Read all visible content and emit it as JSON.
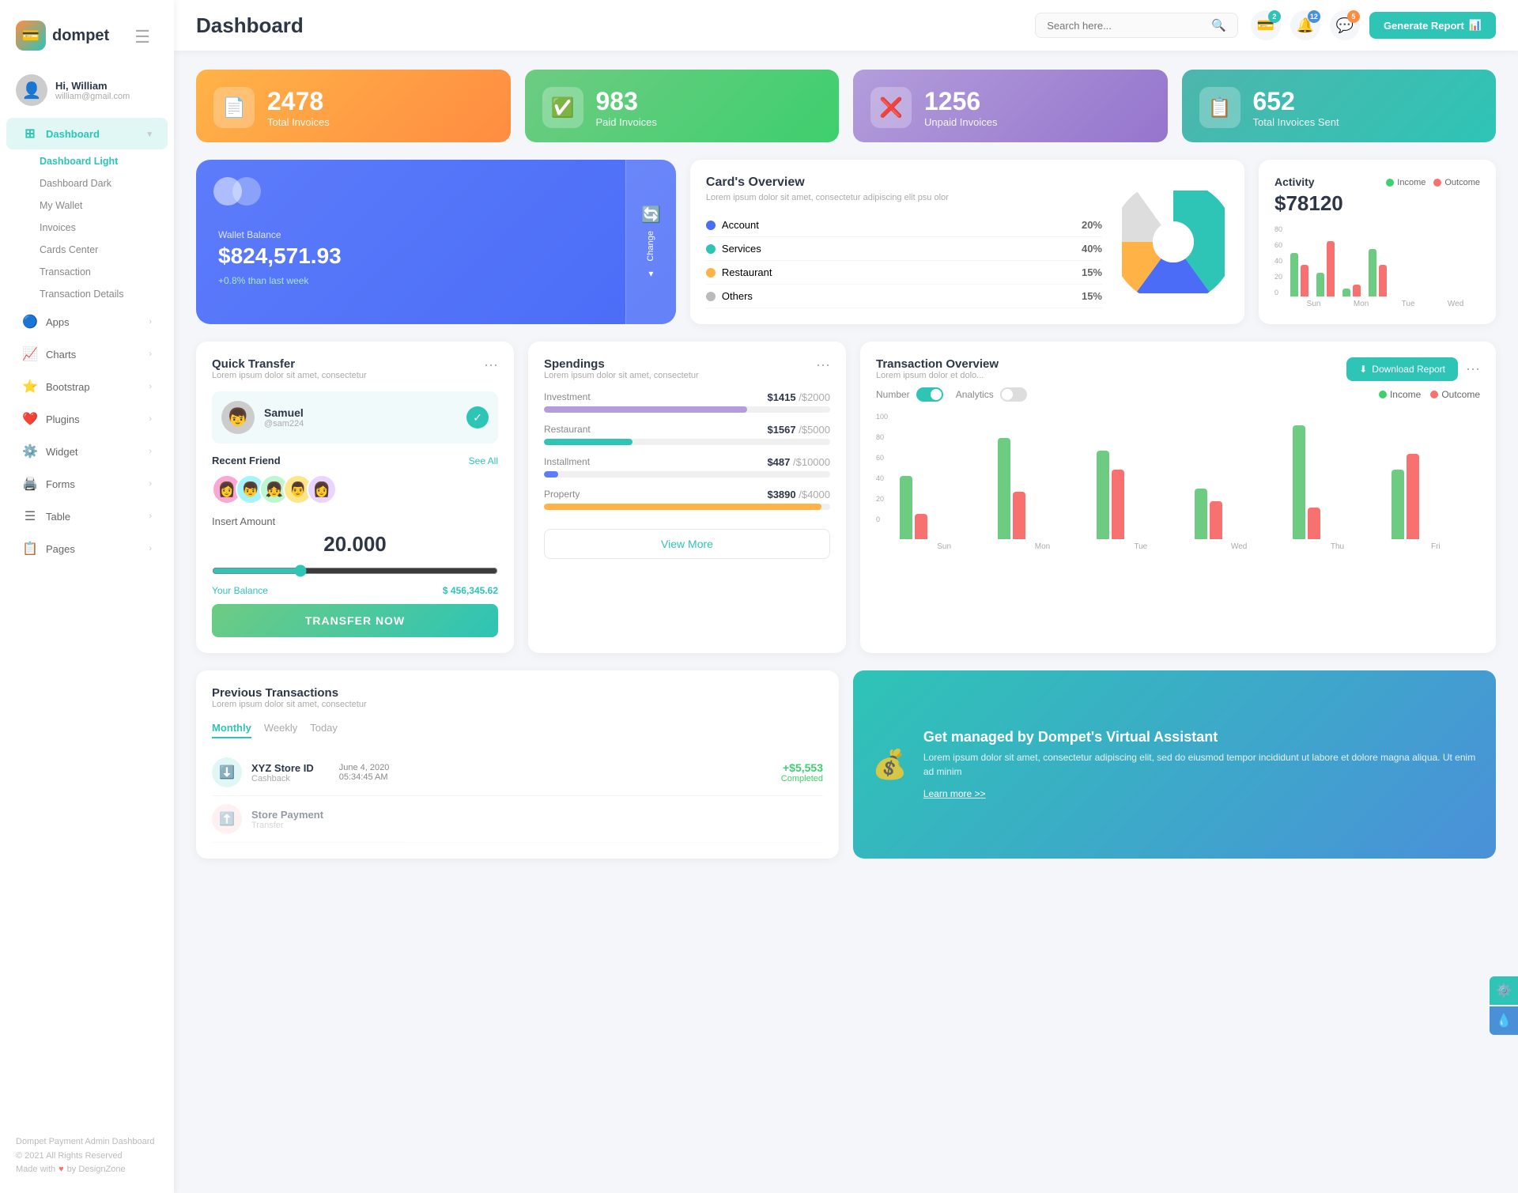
{
  "logo": {
    "text": "dompet",
    "icon": "💳"
  },
  "hamburger": "☰",
  "user": {
    "name": "Hi, William",
    "email": "william@gmail.com",
    "avatar": "👤"
  },
  "nav": {
    "dashboard": {
      "label": "Dashboard",
      "icon": "⊞",
      "active": true,
      "sub_items": [
        "Dashboard Light",
        "Dashboard Dark",
        "My Wallet",
        "Invoices",
        "Cards Center",
        "Transaction",
        "Transaction Details"
      ]
    },
    "apps": {
      "label": "Apps",
      "icon": "🔵"
    },
    "charts": {
      "label": "Charts",
      "icon": "📈"
    },
    "bootstrap": {
      "label": "Bootstrap",
      "icon": "⭐"
    },
    "plugins": {
      "label": "Plugins",
      "icon": "❤️"
    },
    "widget": {
      "label": "Widget",
      "icon": "⚙️"
    },
    "forms": {
      "label": "Forms",
      "icon": "🖨️"
    },
    "table": {
      "label": "Table",
      "icon": "☰"
    },
    "pages": {
      "label": "Pages",
      "icon": "📋"
    }
  },
  "sidebar_footer": {
    "line1": "Dompet Payment Admin Dashboard",
    "line2": "© 2021 All Rights Reserved",
    "line3": "Made with ♥ by DesignZone"
  },
  "topbar": {
    "title": "Dashboard",
    "search_placeholder": "Search here...",
    "generate_btn": "Generate Report",
    "badge_wallet": "2",
    "badge_bell": "12",
    "badge_chat": "5"
  },
  "stats": [
    {
      "number": "2478",
      "label": "Total Invoices",
      "icon": "📄",
      "color": "orange"
    },
    {
      "number": "983",
      "label": "Paid Invoices",
      "icon": "✅",
      "color": "green"
    },
    {
      "number": "1256",
      "label": "Unpaid Invoices",
      "icon": "❌",
      "color": "purple"
    },
    {
      "number": "652",
      "label": "Total Invoices Sent",
      "icon": "📋",
      "color": "teal"
    }
  ],
  "wallet": {
    "amount": "$824,571.93",
    "label": "Wallet Balance",
    "change": "+0.8% than last week",
    "change_btn": "Change"
  },
  "cards_overview": {
    "title": "Card's Overview",
    "subtitle": "Lorem ipsum dolor sit amet, consectetur adipiscing elit psu olor",
    "legend": [
      {
        "label": "Account",
        "pct": "20%",
        "color": "#4a6cf7"
      },
      {
        "label": "Services",
        "pct": "40%",
        "color": "#2ec4b6"
      },
      {
        "label": "Restaurant",
        "pct": "15%",
        "color": "#ffb347"
      },
      {
        "label": "Others",
        "pct": "15%",
        "color": "#bbb"
      }
    ]
  },
  "activity": {
    "title": "Activity",
    "amount": "$78120",
    "income_label": "Income",
    "outcome_label": "Outcome",
    "bars": [
      {
        "day": "Sun",
        "income": 55,
        "outcome": 40
      },
      {
        "day": "Mon",
        "income": 30,
        "outcome": 70
      },
      {
        "day": "Tue",
        "income": 10,
        "outcome": 15
      },
      {
        "day": "Wed",
        "income": 60,
        "outcome": 40
      }
    ]
  },
  "quick_transfer": {
    "title": "Quick Transfer",
    "subtitle": "Lorem ipsum dolor sit amet, consectetur",
    "user_name": "Samuel",
    "user_id": "@sam224",
    "recent_friends_label": "Recent Friend",
    "see_all": "See All",
    "insert_amount_label": "Insert Amount",
    "amount": "20.000",
    "balance_label": "Your Balance",
    "balance_value": "$ 456,345.62",
    "transfer_btn": "TRANSFER NOW"
  },
  "spendings": {
    "title": "Spendings",
    "subtitle": "Lorem ipsum dolor sit amet, consectetur",
    "items": [
      {
        "label": "Investment",
        "amount": "$1415",
        "total": "/$2000",
        "pct": 71,
        "color": "purple"
      },
      {
        "label": "Restaurant",
        "amount": "$1567",
        "total": "/$5000",
        "pct": 31,
        "color": "teal"
      },
      {
        "label": "Installment",
        "amount": "$487",
        "total": "/$10000",
        "pct": 5,
        "color": "blue"
      },
      {
        "label": "Property",
        "amount": "$3890",
        "total": "/$4000",
        "pct": 97,
        "color": "orange"
      }
    ],
    "view_more_btn": "View More"
  },
  "transaction_overview": {
    "title": "Transaction Overview",
    "subtitle": "Lorem ipsum dolor et dolo...",
    "download_btn": "Download Report",
    "number_label": "Number",
    "analytics_label": "Analytics",
    "income_label": "Income",
    "outcome_label": "Outcome",
    "bars": [
      {
        "day": "Sun",
        "income": 50,
        "outcome": 20
      },
      {
        "day": "Mon",
        "income": 80,
        "outcome": 38
      },
      {
        "day": "Tue",
        "income": 70,
        "outcome": 55
      },
      {
        "day": "Wed",
        "income": 40,
        "outcome": 30
      },
      {
        "day": "Thu",
        "income": 90,
        "outcome": 25
      },
      {
        "day": "Fri",
        "income": 55,
        "outcome": 68
      }
    ],
    "y_labels": [
      "0",
      "20",
      "40",
      "60",
      "80",
      "100"
    ]
  },
  "prev_transactions": {
    "title": "Previous Transactions",
    "subtitle": "Lorem ipsum dolor sit amet, consectetur",
    "tabs": [
      "Monthly",
      "Weekly",
      "Today"
    ],
    "active_tab": "Monthly",
    "items": [
      {
        "name": "XYZ Store ID",
        "type": "Cashback",
        "date": "June 4, 2020",
        "time": "05:34:45 AM",
        "amount": "+$5,553",
        "status": "Completed",
        "icon": "⬇️"
      }
    ]
  },
  "virtual_assistant": {
    "title": "Get managed by Dompet's Virtual Assistant",
    "desc": "Lorem ipsum dolor sit amet, consectetur adipiscing elit, sed do eiusmod tempor incididunt ut labore et dolore magna aliqua. Ut enim ad minim",
    "link": "Learn more >>",
    "icon": "💰"
  }
}
